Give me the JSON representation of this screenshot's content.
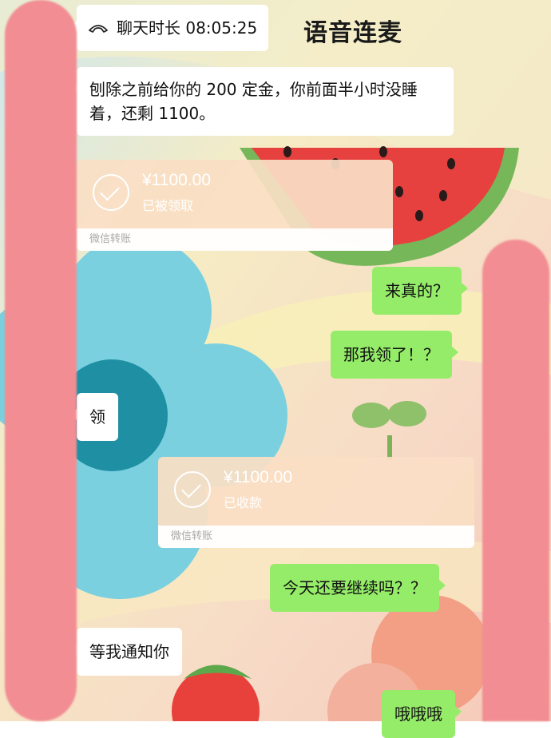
{
  "header": {
    "call_duration": "聊天时长 08:05:25",
    "title": "语音连麦"
  },
  "messages": [
    {
      "side": "left",
      "text": "刨除之前给你的 200 定金，你前面半小时没睡着，还剩 1100。"
    },
    {
      "side": "left",
      "type": "transfer",
      "amount": "¥1100.00",
      "status": "已被领取",
      "footer": "微信转账"
    },
    {
      "side": "right",
      "text": "来真的？"
    },
    {
      "side": "right",
      "text": "那我领了！？"
    },
    {
      "side": "left",
      "text": "领"
    },
    {
      "side": "right",
      "type": "transfer",
      "amount": "¥1100.00",
      "status": "已收款",
      "footer": "微信转账"
    },
    {
      "side": "right",
      "text": "今天还要继续吗？？"
    },
    {
      "side": "left",
      "text": "等我通知你"
    },
    {
      "side": "right",
      "text": "哦哦哦"
    }
  ],
  "icons": {
    "call_icon": "phone-hangup-icon",
    "check_icon": "check-circle-icon"
  },
  "colors": {
    "sent_bubble": "#95ec69",
    "received_bubble": "#ffffff",
    "transfer_card": "#fadec4",
    "redaction": "#f28d93"
  }
}
